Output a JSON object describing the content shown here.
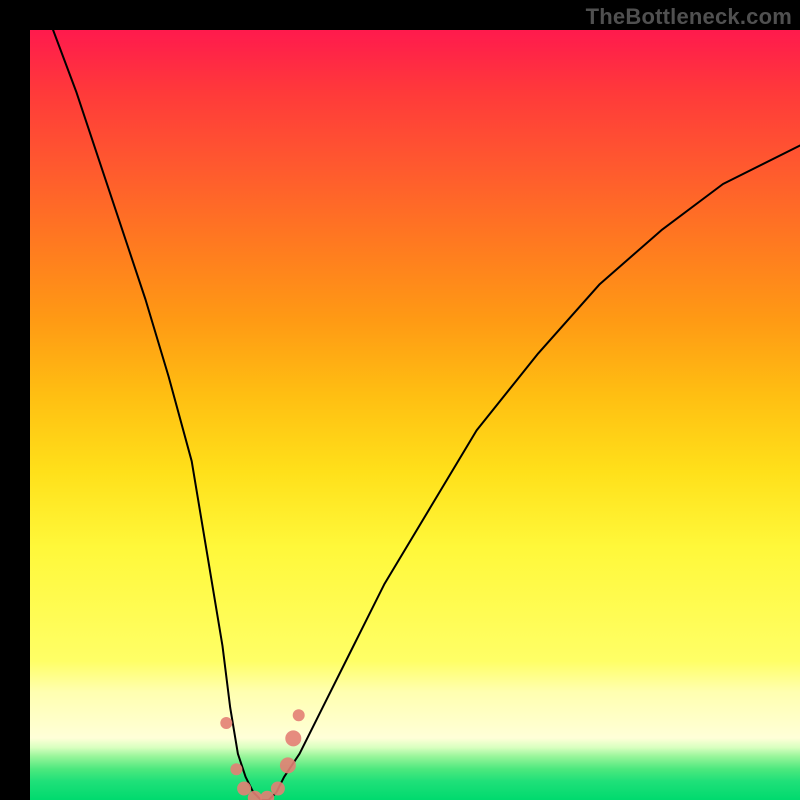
{
  "attribution": "TheBottleneck.com",
  "chart_data": {
    "type": "line",
    "title": "",
    "xlabel": "",
    "ylabel": "",
    "xlim": [
      0,
      100
    ],
    "ylim": [
      0,
      100
    ],
    "grid": false,
    "legend": false,
    "gradient_stops_pct": {
      "red_top": 0,
      "orange": 45,
      "yellow": 78,
      "pale_yellow": 88,
      "green_bottom": 100
    },
    "series": [
      {
        "name": "bottleneck-curve",
        "x": [
          3,
          6,
          9,
          12,
          15,
          18,
          21,
          23,
          25,
          26,
          27,
          28,
          29,
          30,
          31,
          32,
          33,
          35,
          38,
          42,
          46,
          52,
          58,
          66,
          74,
          82,
          90,
          100
        ],
        "values": [
          100,
          92,
          83,
          74,
          65,
          55,
          44,
          32,
          20,
          12,
          6,
          3,
          1,
          0,
          0,
          1,
          3,
          6,
          12,
          20,
          28,
          38,
          48,
          58,
          67,
          74,
          80,
          85
        ]
      }
    ],
    "markers": [
      {
        "x": 25.5,
        "y": 10,
        "r": 6
      },
      {
        "x": 26.8,
        "y": 4,
        "r": 6
      },
      {
        "x": 27.8,
        "y": 1.5,
        "r": 7
      },
      {
        "x": 29.2,
        "y": 0.3,
        "r": 7
      },
      {
        "x": 30.8,
        "y": 0.3,
        "r": 7
      },
      {
        "x": 32.2,
        "y": 1.5,
        "r": 7
      },
      {
        "x": 33.5,
        "y": 4.5,
        "r": 8
      },
      {
        "x": 34.2,
        "y": 8,
        "r": 8
      },
      {
        "x": 34.9,
        "y": 11,
        "r": 6
      }
    ],
    "marker_color": "#e38074"
  }
}
